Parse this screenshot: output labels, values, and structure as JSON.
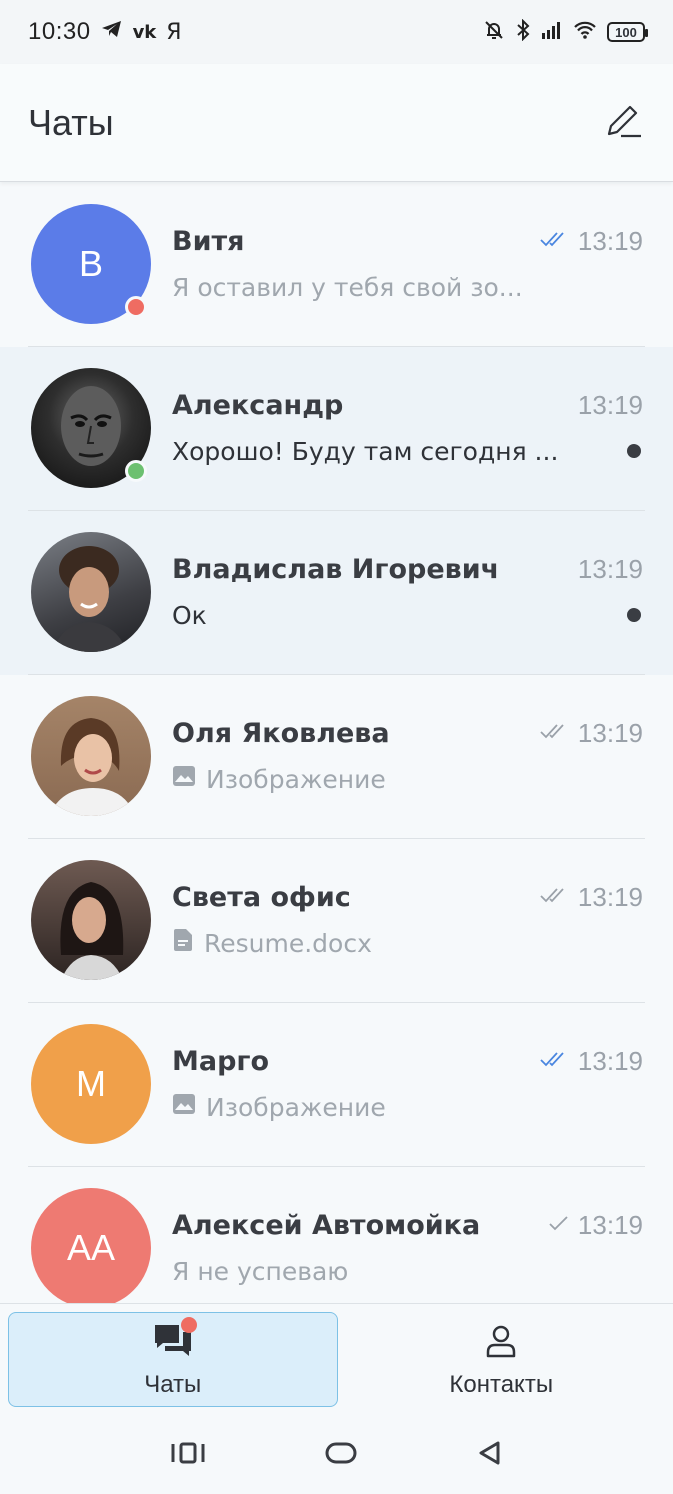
{
  "status_bar": {
    "time": "10:30",
    "app_icons": [
      "telegram-icon",
      "vk-icon",
      "yandex-icon"
    ],
    "vk_text": "vk",
    "yandex_text": "Я",
    "battery": "100"
  },
  "header": {
    "title": "Чаты",
    "compose_icon": "pencil-icon"
  },
  "chats": [
    {
      "name": "Витя",
      "preview": "Я оставил у тебя свой зо...",
      "time": "13:19",
      "avatar_type": "initials",
      "initials": "В",
      "avatar_color": "#5b7ce8",
      "status_dot": "#ef6c62",
      "receipt": "double-check",
      "receipt_color": "#4a86e0",
      "unread": false
    },
    {
      "name": "Александр",
      "preview": "Хорошо! Буду там сегодня ...",
      "time": "13:19",
      "avatar_type": "photo",
      "avatar_color": "#2b2b2b",
      "status_dot": "#6cc070",
      "receipt": "none",
      "unread": true
    },
    {
      "name": "Владислав Игоревич",
      "preview": "Ок",
      "time": "13:19",
      "avatar_type": "photo",
      "avatar_color": "#5a4a40",
      "status_dot": "",
      "receipt": "none",
      "unread": true
    },
    {
      "name": "Оля Яковлева",
      "preview": "Изображение",
      "preview_icon": "image-icon",
      "time": "13:19",
      "avatar_type": "photo",
      "avatar_color": "#b08a6e",
      "status_dot": "",
      "receipt": "double-check",
      "receipt_color": "#9aa1a9",
      "unread": false
    },
    {
      "name": "Света офис",
      "preview": "Resume.docx",
      "preview_icon": "document-icon",
      "time": "13:19",
      "avatar_type": "photo",
      "avatar_color": "#4e3a33",
      "status_dot": "",
      "receipt": "double-check",
      "receipt_color": "#9aa1a9",
      "unread": false
    },
    {
      "name": "Марго",
      "preview": "Изображение",
      "preview_icon": "image-icon",
      "time": "13:19",
      "avatar_type": "initials",
      "initials": "М",
      "avatar_color": "#f0a04a",
      "status_dot": "",
      "receipt": "double-check",
      "receipt_color": "#4a86e0",
      "unread": false
    },
    {
      "name": "Алексей Автомойка",
      "preview": "Я не успеваю",
      "time": "13:19",
      "avatar_type": "initials",
      "initials": "АА",
      "avatar_color": "#ee7a72",
      "status_dot": "",
      "receipt": "single-check",
      "receipt_color": "#9aa1a9",
      "unread": false
    }
  ],
  "bottom_nav": {
    "tabs": [
      {
        "label": "Чаты",
        "icon": "chat-bubbles-icon",
        "active": true,
        "badge": true
      },
      {
        "label": "Контакты",
        "icon": "person-icon",
        "active": false,
        "badge": false
      }
    ]
  },
  "system_nav": [
    "recents-icon",
    "home-icon",
    "back-icon"
  ]
}
